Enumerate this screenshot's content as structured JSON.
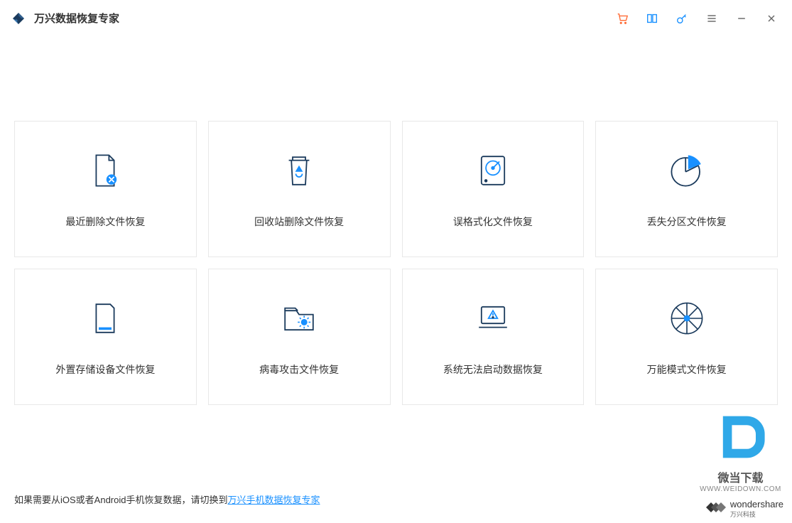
{
  "header": {
    "title": "万兴数据恢复专家"
  },
  "cards": [
    {
      "label": "最近删除文件恢复"
    },
    {
      "label": "回收站删除文件恢复"
    },
    {
      "label": "误格式化文件恢复"
    },
    {
      "label": "丢失分区文件恢复"
    },
    {
      "label": "外置存储设备文件恢复"
    },
    {
      "label": "病毒攻击文件恢复"
    },
    {
      "label": "系统无法启动数据恢复"
    },
    {
      "label": "万能模式文件恢复"
    }
  ],
  "footer": {
    "prefix": "如果需要从iOS或者Android手机恢复数据，请切换到",
    "link": "万兴手机数据恢复专家"
  },
  "watermark": {
    "name": "微当下载",
    "url": "WWW.WEIDOWN.COM"
  },
  "brand": {
    "main": "wondershare",
    "sub": "万兴科技"
  }
}
